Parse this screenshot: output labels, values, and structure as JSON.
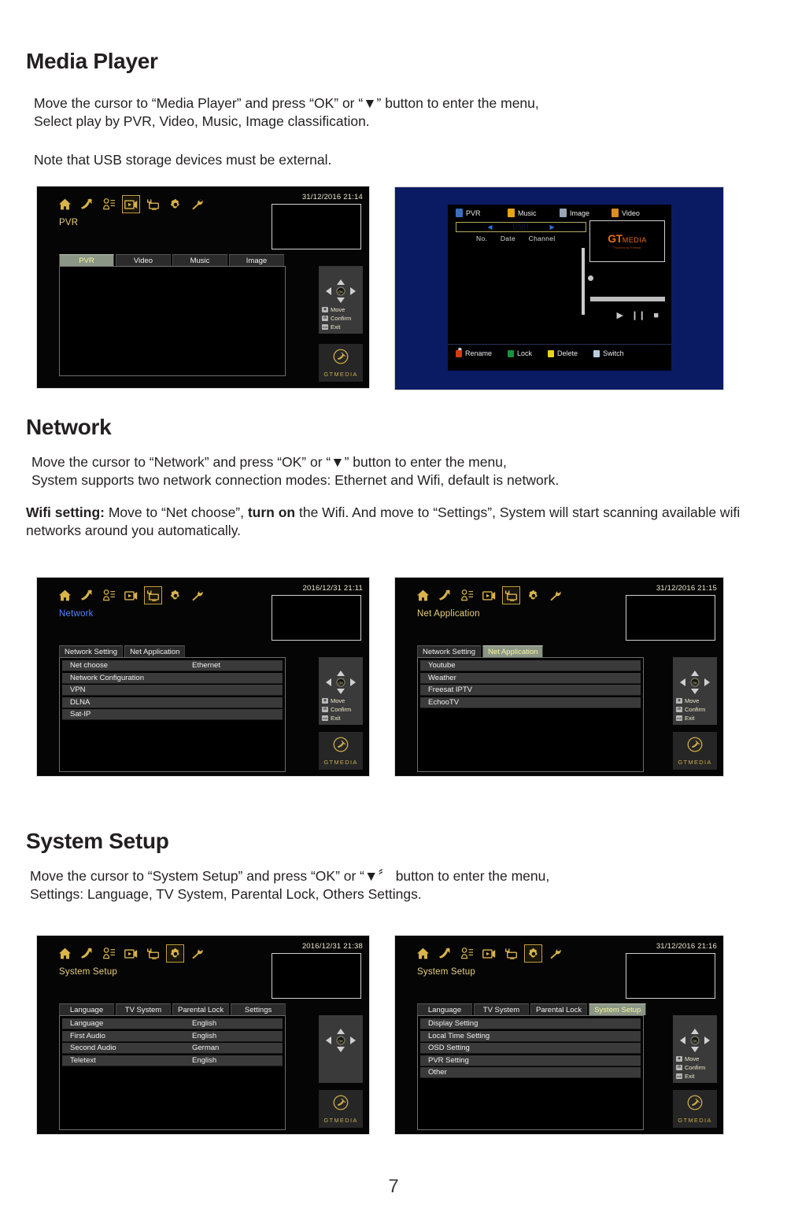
{
  "page": {
    "number": "7"
  },
  "sections": {
    "media_player": {
      "heading": "Media Player",
      "para1_line1": "Move the cursor to “Media Player” and press “OK” or “▼” button to enter the menu,",
      "para1_line2": "Select play by PVR, Video, Music, Image classification.",
      "para2": "Note that USB storage devices must be external."
    },
    "network": {
      "heading": "Network",
      "para1_line1": "Move the cursor to “Network” and press “OK” or “▼” button to enter the menu,",
      "para1_line2": "System supports two network connection modes: Ethernet and Wifi, default is network.",
      "para2_bold1": "Wifi setting:",
      "para2_a": " Move to “Net choose”, ",
      "para2_bold2": "turn on",
      "para2_b": " the Wifi. And move to “Settings”, System will start scanning available wifi networks around you automatically."
    },
    "system_setup": {
      "heading": "System Setup",
      "para1_line1": "Move the cursor to “System Setup” and press “OK” or “▼〞 button to enter the menu,",
      "para1_line2": "Settings: Language, TV System, Parental Lock, Others Settings."
    }
  },
  "icon_names": [
    "home-icon",
    "satellite-dish-icon",
    "user-list-icon",
    "media-player-icon",
    "network-monitor-icon",
    "gear-icon",
    "wrench-icon"
  ],
  "nav_hints": {
    "move": "Move",
    "confirm": "Confirm",
    "exit": "Exit",
    "move_key": "◈",
    "confirm_key": "ok",
    "exit_key": "exit"
  },
  "brand": {
    "logo_text": "GTMEDIA"
  },
  "screens": {
    "pvr": {
      "clock": "31/12/2016  21:14",
      "title": "PVR",
      "selected_icon_index": 3,
      "tabs": [
        {
          "label": "PVR",
          "active": true
        },
        {
          "label": "Video",
          "active": false
        },
        {
          "label": "Music",
          "active": false
        },
        {
          "label": "Image",
          "active": false
        }
      ],
      "rows": []
    },
    "media_blue": {
      "nav": [
        {
          "label": "PVR",
          "color": "#3a6fbd"
        },
        {
          "label": "Music",
          "color": "#e8a317"
        },
        {
          "label": "Image",
          "color": "#9aa6b8"
        },
        {
          "label": "Video",
          "color": "#e08a22"
        }
      ],
      "selector_label": "USB1",
      "columns": [
        "No.",
        "Date",
        "Channel"
      ],
      "transport": [
        "▶",
        "❙❙",
        "■"
      ],
      "color_buttons": [
        {
          "label": "Rename",
          "color": "#d33b10"
        },
        {
          "label": "Lock",
          "color": "#16923b"
        },
        {
          "label": "Delete",
          "color": "#e8d41a"
        },
        {
          "label": "Switch",
          "color": "#b9cfe0"
        }
      ],
      "logo_main": "GT",
      "logo_sub": "MEDIA",
      "logo_tag": "Powered by Freesat"
    },
    "network": {
      "clock": "2016/12/31  21:11",
      "title": "Network",
      "selected_icon_index": 4,
      "tabs": [
        {
          "label": "Network Setting",
          "active": false
        },
        {
          "label": "Net Application",
          "active": false
        }
      ],
      "rows": [
        {
          "label": "Net choose",
          "value": "Ethernet"
        },
        {
          "label": "Network Configuration",
          "value": ""
        },
        {
          "label": "VPN",
          "value": ""
        },
        {
          "label": "DLNA",
          "value": ""
        },
        {
          "label": "Sat-IP",
          "value": ""
        }
      ]
    },
    "net_application": {
      "clock": "31/12/2016  21:15",
      "title": "Net Application",
      "selected_icon_index": 4,
      "tabs": [
        {
          "label": "Network Setting",
          "active": false
        },
        {
          "label": "Net Application",
          "active": true
        }
      ],
      "rows": [
        {
          "label": "Youtube",
          "value": ""
        },
        {
          "label": "Weather",
          "value": ""
        },
        {
          "label": "Freesat IPTV",
          "value": ""
        },
        {
          "label": "EchooTV",
          "value": ""
        }
      ]
    },
    "system_language": {
      "clock": "2016/12/31  21:38",
      "title": "System Setup",
      "selected_icon_index": 5,
      "tabs": [
        {
          "label": "Language",
          "active": false
        },
        {
          "label": "TV System",
          "active": false
        },
        {
          "label": "Parental Lock",
          "active": false
        },
        {
          "label": "Settings",
          "active": false
        }
      ],
      "rows": [
        {
          "label": "Language",
          "value": "English"
        },
        {
          "label": "First Audio",
          "value": "English"
        },
        {
          "label": "Second Audio",
          "value": "German"
        },
        {
          "label": "Teletext",
          "value": "English"
        }
      ],
      "show_hints": false
    },
    "system_setup": {
      "clock": "31/12/2016  21:16",
      "title": "System Setup",
      "selected_icon_index": 5,
      "tabs": [
        {
          "label": "Language",
          "active": false
        },
        {
          "label": "TV System",
          "active": false
        },
        {
          "label": "Parental Lock",
          "active": false
        },
        {
          "label": "System Setup",
          "active": true
        }
      ],
      "rows": [
        {
          "label": "Display Setting",
          "value": ""
        },
        {
          "label": "Local Time Setting",
          "value": ""
        },
        {
          "label": "OSD Setting",
          "value": ""
        },
        {
          "label": "PVR Setting",
          "value": ""
        },
        {
          "label": "Other",
          "value": ""
        }
      ],
      "show_hints": true
    }
  }
}
